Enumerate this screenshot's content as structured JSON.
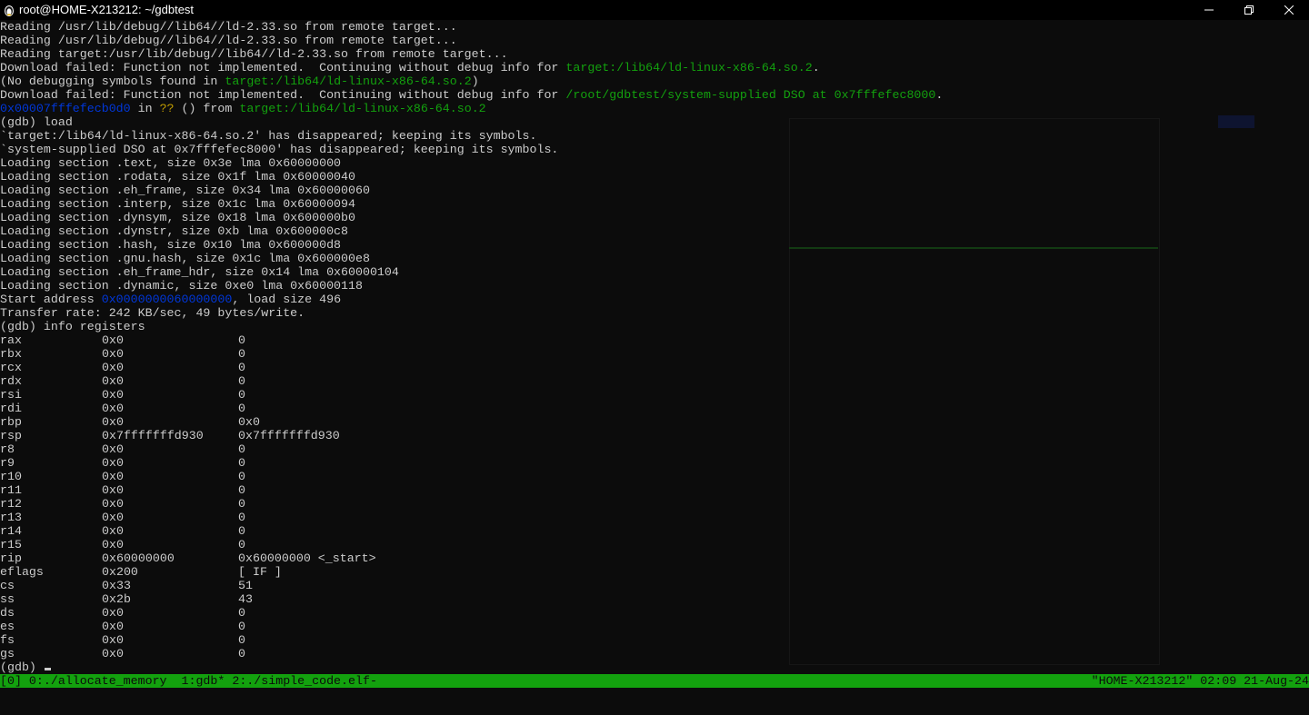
{
  "window": {
    "title": "root@HOME-X213212: ~/gdbtest",
    "icon": "linux-penguin-icon",
    "controls": [
      "minimize-icon",
      "restore-icon",
      "close-icon"
    ]
  },
  "colors": {
    "background": "#0c0c0c",
    "text": "#cccccc",
    "green": "#13a10e",
    "blue": "#0037da",
    "yellow": "#c19c00",
    "status_bar": "#13a10e"
  },
  "output_lines": [
    [
      {
        "t": "Reading /usr/lib/debug//lib64//ld-2.33.so from remote target..."
      }
    ],
    [
      {
        "t": "Reading /usr/lib/debug//lib64//ld-2.33.so from remote target..."
      }
    ],
    [
      {
        "t": "Reading target:/usr/lib/debug//lib64//ld-2.33.so from remote target..."
      }
    ],
    [
      {
        "t": "Download failed: Function not implemented.  Continuing without debug info for "
      },
      {
        "t": "target:/lib64/ld-linux-x86-64.so.2",
        "c": "green"
      },
      {
        "t": "."
      }
    ],
    [
      {
        "t": "(No debugging symbols found in "
      },
      {
        "t": "target:/lib64/ld-linux-x86-64.so.2",
        "c": "green"
      },
      {
        "t": ")"
      }
    ],
    [
      {
        "t": "Download failed: Function not implemented.  Continuing without debug info for "
      },
      {
        "t": "/root/gdbtest/system-supplied DSO at 0x7fffefec8000",
        "c": "green"
      },
      {
        "t": "."
      }
    ],
    [
      {
        "t": "0x00007fffefecb0d0",
        "c": "blue"
      },
      {
        "t": " in "
      },
      {
        "t": "??",
        "c": "yellow"
      },
      {
        "t": " () from "
      },
      {
        "t": "target:/lib64/ld-linux-x86-64.so.2",
        "c": "green"
      }
    ],
    [
      {
        "t": "(gdb) load"
      }
    ],
    [
      {
        "t": "`target:/lib64/ld-linux-x86-64.so.2' has disappeared; keeping its symbols."
      }
    ],
    [
      {
        "t": "`system-supplied DSO at 0x7fffefec8000' has disappeared; keeping its symbols."
      }
    ],
    [
      {
        "t": "Loading section .text, size 0x3e lma 0x60000000"
      }
    ],
    [
      {
        "t": "Loading section .rodata, size 0x1f lma 0x60000040"
      }
    ],
    [
      {
        "t": "Loading section .eh_frame, size 0x34 lma 0x60000060"
      }
    ],
    [
      {
        "t": "Loading section .interp, size 0x1c lma 0x60000094"
      }
    ],
    [
      {
        "t": "Loading section .dynsym, size 0x18 lma 0x600000b0"
      }
    ],
    [
      {
        "t": "Loading section .dynstr, size 0xb lma 0x600000c8"
      }
    ],
    [
      {
        "t": "Loading section .hash, size 0x10 lma 0x600000d8"
      }
    ],
    [
      {
        "t": "Loading section .gnu.hash, size 0x1c lma 0x600000e8"
      }
    ],
    [
      {
        "t": "Loading section .eh_frame_hdr, size 0x14 lma 0x60000104"
      }
    ],
    [
      {
        "t": "Loading section .dynamic, size 0xe0 lma 0x60000118"
      }
    ],
    [
      {
        "t": "Start address "
      },
      {
        "t": "0x0000000060000000",
        "c": "blue"
      },
      {
        "t": ", load size 496"
      }
    ],
    [
      {
        "t": "Transfer rate: 242 KB/sec, 49 bytes/write."
      }
    ],
    [
      {
        "t": "(gdb) info registers"
      }
    ]
  ],
  "registers": [
    {
      "name": "rax",
      "hex": "0x0",
      "natural": "0"
    },
    {
      "name": "rbx",
      "hex": "0x0",
      "natural": "0"
    },
    {
      "name": "rcx",
      "hex": "0x0",
      "natural": "0"
    },
    {
      "name": "rdx",
      "hex": "0x0",
      "natural": "0"
    },
    {
      "name": "rsi",
      "hex": "0x0",
      "natural": "0"
    },
    {
      "name": "rdi",
      "hex": "0x0",
      "natural": "0"
    },
    {
      "name": "rbp",
      "hex": "0x0",
      "natural": "0x0"
    },
    {
      "name": "rsp",
      "hex": "0x7fffffffd930",
      "natural": "0x7fffffffd930"
    },
    {
      "name": "r8",
      "hex": "0x0",
      "natural": "0"
    },
    {
      "name": "r9",
      "hex": "0x0",
      "natural": "0"
    },
    {
      "name": "r10",
      "hex": "0x0",
      "natural": "0"
    },
    {
      "name": "r11",
      "hex": "0x0",
      "natural": "0"
    },
    {
      "name": "r12",
      "hex": "0x0",
      "natural": "0"
    },
    {
      "name": "r13",
      "hex": "0x0",
      "natural": "0"
    },
    {
      "name": "r14",
      "hex": "0x0",
      "natural": "0"
    },
    {
      "name": "r15",
      "hex": "0x0",
      "natural": "0"
    },
    {
      "name": "rip",
      "hex": "0x60000000",
      "natural": "0x60000000 <_start>"
    },
    {
      "name": "eflags",
      "hex": "0x200",
      "natural": "[ IF ]"
    },
    {
      "name": "cs",
      "hex": "0x33",
      "natural": "51"
    },
    {
      "name": "ss",
      "hex": "0x2b",
      "natural": "43"
    },
    {
      "name": "ds",
      "hex": "0x0",
      "natural": "0"
    },
    {
      "name": "es",
      "hex": "0x0",
      "natural": "0"
    },
    {
      "name": "fs",
      "hex": "0x0",
      "natural": "0"
    },
    {
      "name": "gs",
      "hex": "0x0",
      "natural": "0"
    }
  ],
  "prompt": "(gdb) ",
  "status_bar": {
    "left": "[0] 0:./allocate_memory  1:gdb* 2:./simple_code.elf-",
    "right": "\"HOME-X213212\" 02:09 21-Aug-24"
  }
}
